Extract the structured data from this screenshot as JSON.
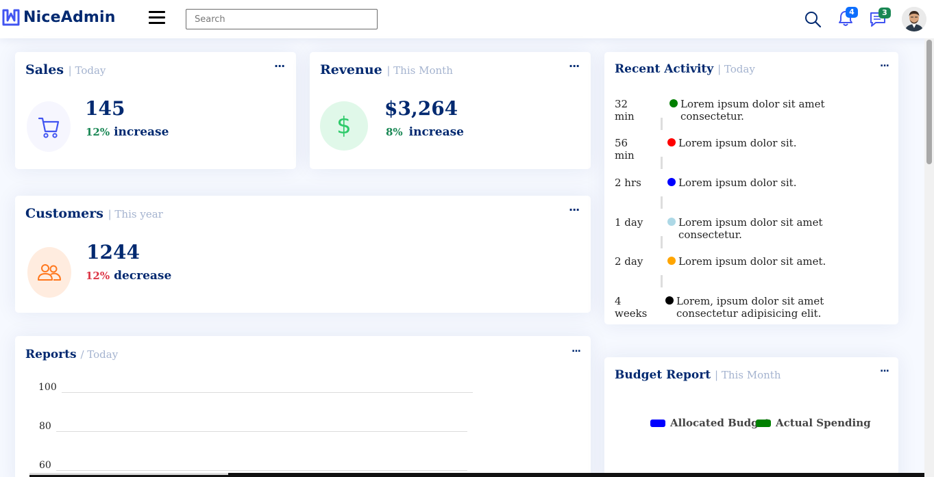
{
  "header": {
    "brand": "NiceAdmin",
    "search_placeholder": "Search",
    "notifications_count": "4",
    "messages_count": "3"
  },
  "sales": {
    "title": "Sales",
    "period": "| Today",
    "value": "145",
    "percent": "12%",
    "trend": "increase",
    "menu": "..."
  },
  "revenue": {
    "title": "Revenue",
    "period": "| This Month",
    "value": "$3,264",
    "percent": "8%",
    "trend": "increase",
    "currency_symbol": "$",
    "menu": "..."
  },
  "customers": {
    "title": "Customers",
    "period": "| This year",
    "value": "1244",
    "percent": "12%",
    "trend": "decrease",
    "menu": "..."
  },
  "reports": {
    "title": "Reports",
    "period": "/ Today",
    "menu": "...",
    "ticks": [
      "100",
      "80",
      "60"
    ]
  },
  "activity": {
    "title": "Recent Activity",
    "period": "| Today",
    "menu": "...",
    "items": [
      {
        "time": "32 min",
        "text": "Lorem ipsum dolor sit amet consectetur.",
        "color": "#008000"
      },
      {
        "time": "56 min",
        "text": "Lorem ipsum dolor sit.",
        "color": "#ff0000"
      },
      {
        "time": "2 hrs",
        "text": "Lorem ipsum dolor sit.",
        "color": "#0000ff"
      },
      {
        "time": "1 day",
        "text": "Lorem ipsum dolor sit amet consectetur.",
        "color": "#add8e6"
      },
      {
        "time": "2 day",
        "text": "Lorem ipsum dolor sit amet.",
        "color": "#ffa500"
      },
      {
        "time": "4 weeks",
        "text": "Lorem, ipsum dolor sit amet consectetur adipisicing elit.",
        "color": "#000000"
      }
    ]
  },
  "budget": {
    "title": "Budget Report",
    "period": "| This Month",
    "menu": "...",
    "legend": [
      {
        "label": "Allocated Budget",
        "color": "#0000ff"
      },
      {
        "label": "Actual Spending",
        "color": "#008000"
      }
    ]
  },
  "colors": {
    "brand": "#012970",
    "accent": "#4154f1",
    "increase": "#198754",
    "decrease": "#dc3545"
  }
}
